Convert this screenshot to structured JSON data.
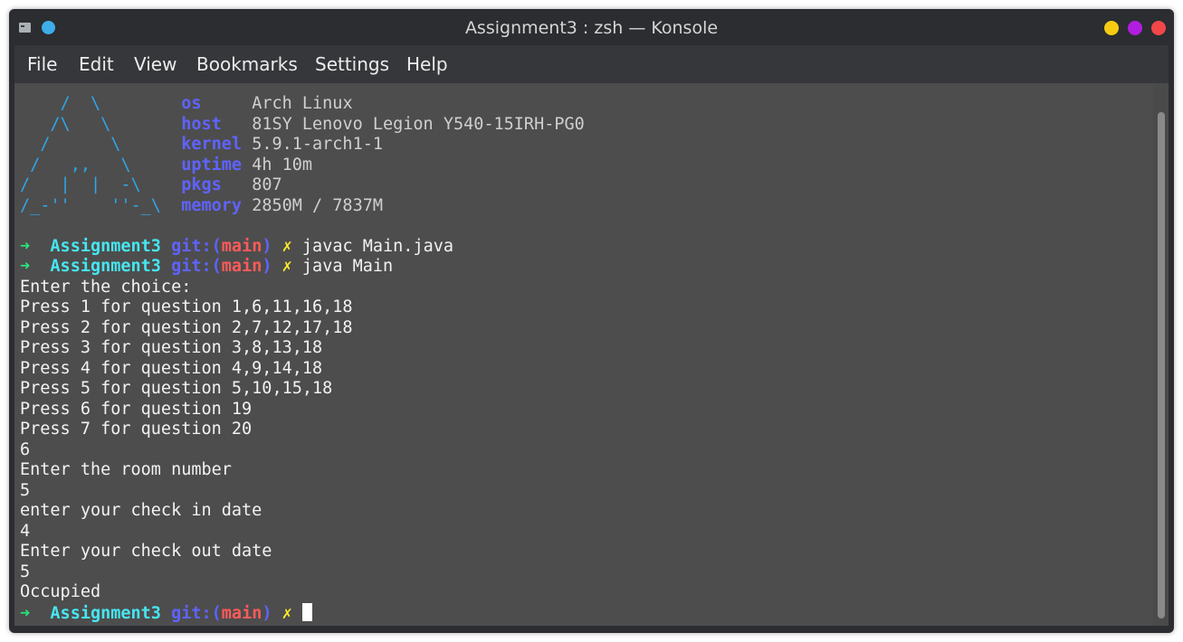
{
  "window": {
    "title": "Assignment3 : zsh — Konsole",
    "buttons": {
      "minimize_color": "#f5cc12",
      "maximize_color": "#b11ee0",
      "close_color": "#f3474a"
    },
    "pin_color": "#3daee9"
  },
  "menu": {
    "items": [
      "File",
      "Edit",
      "View",
      "Bookmarks",
      "Settings",
      "Help"
    ]
  },
  "fetch": {
    "art": [
      "    /  \\    ",
      "   /\\   \\   ",
      "  /      \\  ",
      " /   ,,   \\ ",
      "/   |  |  -\\ ",
      "/_-''    ''-_\\"
    ],
    "info": [
      {
        "label": "os",
        "value": "Arch Linux"
      },
      {
        "label": "host",
        "value": "81SY Lenovo Legion Y540-15IRH-PG0"
      },
      {
        "label": "kernel",
        "value": "5.9.1-arch1-1"
      },
      {
        "label": "uptime",
        "value": "4h 10m"
      },
      {
        "label": "pkgs",
        "value": "807"
      },
      {
        "label": "memory",
        "value": "2850M / 7837M"
      }
    ]
  },
  "prompt": {
    "arrow": "➜",
    "dir": "Assignment3",
    "git_prefix": "git:(",
    "branch": "main",
    "git_suffix": ")",
    "dirty_mark": "✗"
  },
  "commands": [
    "javac Main.java",
    "java Main"
  ],
  "output": [
    "Enter the choice:",
    "Press 1 for question 1,6,11,16,18",
    "Press 2 for question 2,7,12,17,18",
    "Press 3 for question 3,8,13,18",
    "Press 4 for question 4,9,14,18",
    "Press 5 for question 5,10,15,18",
    "Press 6 for question 19",
    "Press 7 for question 20",
    "6",
    "Enter the room number",
    "5",
    "enter your check in date",
    "4",
    "Enter your check out date",
    "5",
    "Occupied"
  ],
  "colors": {
    "terminal_bg": "#4d4d4d",
    "art": "#2fa6e8",
    "label": "#5f63ff",
    "arrow": "#29e37a",
    "dir": "#46e6f0",
    "branch": "#ff5a5a",
    "dirty": "#ffea2b"
  }
}
